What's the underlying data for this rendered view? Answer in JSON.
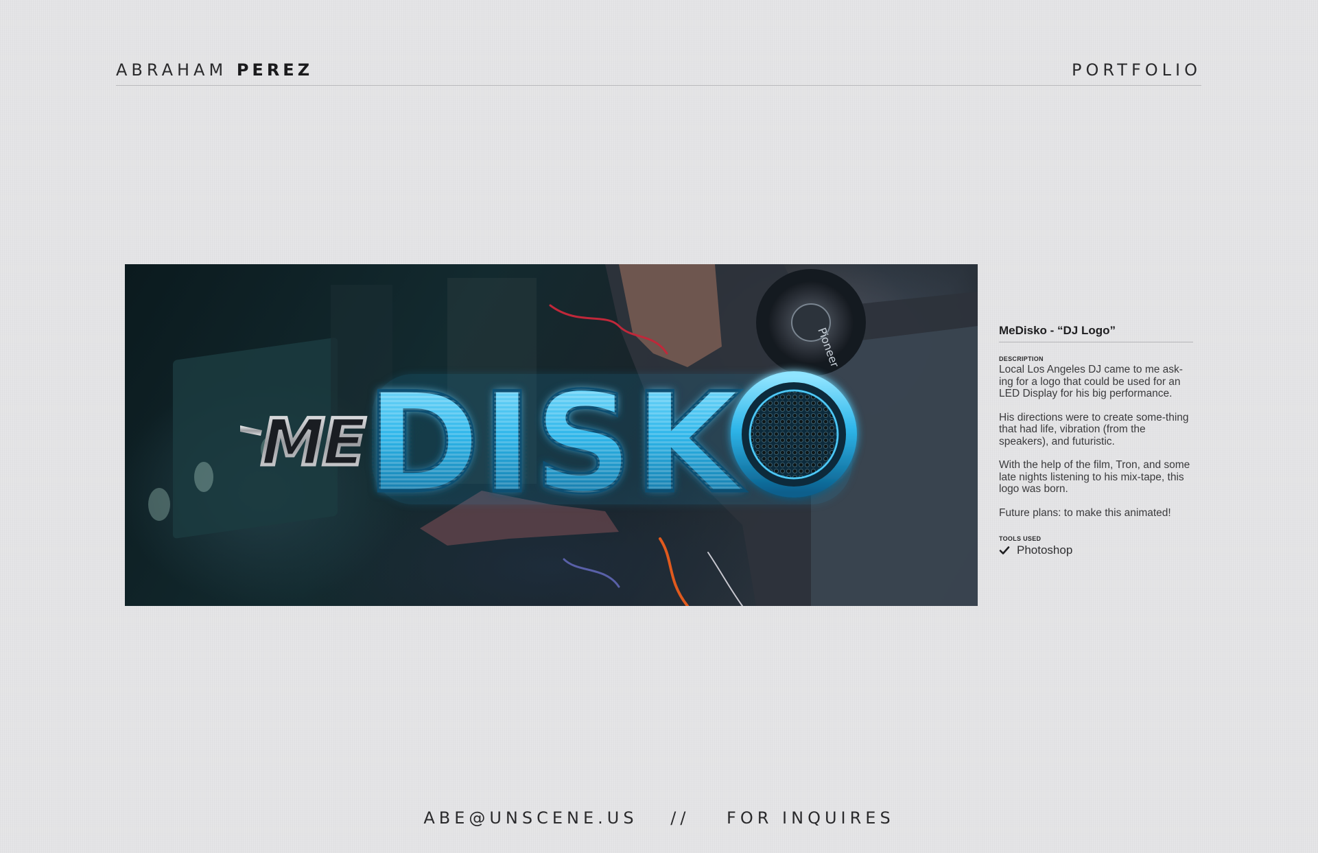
{
  "header": {
    "first_name": "ABRAHAM",
    "last_name": "PEREZ",
    "nav_label": "PORTFOLIO"
  },
  "artwork": {
    "logo_prefix": "ME",
    "logo_main": "DISK",
    "logo_tail": "O",
    "headphone_brand": "Pioneer"
  },
  "project": {
    "title": "MeDisko - “DJ Logo”",
    "description_label": "DESCRIPTION",
    "paragraphs": [
      "Local Los Angeles DJ came to me ask-ing for a logo that could be used for an LED Display for his big performance.",
      "His directions were to create some-thing that had life, vibration (from the speakers), and futuristic.",
      "With the help of the film, Tron, and some late nights listening to his mix-tape, this logo was born.",
      "Future plans: to make this animated!"
    ],
    "tools_label": "TOOLS USED",
    "tools": [
      "Photoshop"
    ]
  },
  "footer": {
    "email": "ABE@UNSCENE.US",
    "separator": "//",
    "cta": "FOR INQUIRES"
  },
  "colors": {
    "background": "#e4e4e6",
    "text": "#2a2a2c",
    "logo_blue": "#2fb6ea",
    "logo_chrome": "#c9c9cc"
  },
  "icons": {
    "tool_check": "check-icon"
  }
}
